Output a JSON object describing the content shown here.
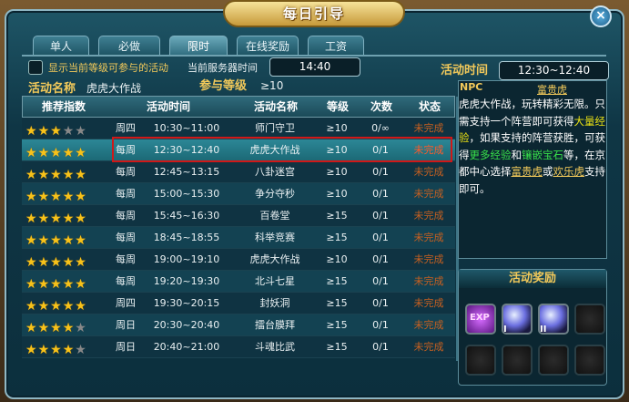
{
  "window": {
    "title": "每日引导",
    "close_label": "×"
  },
  "tabs": [
    {
      "label": "单人",
      "active": false
    },
    {
      "label": "必做",
      "active": false
    },
    {
      "label": "限时",
      "active": true
    },
    {
      "label": "在线奖励",
      "active": false
    },
    {
      "label": "工资",
      "active": false
    }
  ],
  "filter": {
    "checkbox_label": "显示当前等级可参与的活动",
    "server_time_label": "当前服务器时间",
    "server_time": "14:40"
  },
  "activity": {
    "name_label": "活动名称",
    "name_value": "虎虎大作战",
    "level_label": "参与等级",
    "level_value": "≥10"
  },
  "table": {
    "headers": [
      "推荐指数",
      "活动时间",
      "活动名称",
      "等级",
      "次数",
      "状态"
    ],
    "rows": [
      {
        "stars": 3,
        "day": "周四",
        "time": "10:30~11:00",
        "name": "师门守卫",
        "level": "≥10",
        "count": "0/∞",
        "status": "未完成"
      },
      {
        "stars": 5,
        "day": "每周",
        "time": "12:30~12:40",
        "name": "虎虎大作战",
        "level": "≥10",
        "count": "0/1",
        "status": "未完成",
        "selected": true
      },
      {
        "stars": 5,
        "day": "每周",
        "time": "12:45~13:15",
        "name": "八卦迷宫",
        "level": "≥10",
        "count": "0/1",
        "status": "未完成"
      },
      {
        "stars": 5,
        "day": "每周",
        "time": "15:00~15:30",
        "name": "争分夺秒",
        "level": "≥10",
        "count": "0/1",
        "status": "未完成"
      },
      {
        "stars": 5,
        "day": "每周",
        "time": "15:45~16:30",
        "name": "百卷堂",
        "level": "≥15",
        "count": "0/1",
        "status": "未完成"
      },
      {
        "stars": 5,
        "day": "每周",
        "time": "18:45~18:55",
        "name": "科举竞赛",
        "level": "≥15",
        "count": "0/1",
        "status": "未完成"
      },
      {
        "stars": 5,
        "day": "每周",
        "time": "19:00~19:10",
        "name": "虎虎大作战",
        "level": "≥10",
        "count": "0/1",
        "status": "未完成"
      },
      {
        "stars": 5,
        "day": "每周",
        "time": "19:20~19:30",
        "name": "北斗七星",
        "level": "≥15",
        "count": "0/1",
        "status": "未完成"
      },
      {
        "stars": 5,
        "day": "周四",
        "time": "19:30~20:15",
        "name": "封妖洞",
        "level": "≥15",
        "count": "0/1",
        "status": "未完成"
      },
      {
        "stars": 4,
        "day": "周日",
        "time": "20:30~20:40",
        "name": "擂台膜拜",
        "level": "≥15",
        "count": "0/1",
        "status": "未完成"
      },
      {
        "stars": 4,
        "day": "周日",
        "time": "20:40~21:00",
        "name": "斗魂比武",
        "level": "≥15",
        "count": "0/1",
        "status": "未完成"
      }
    ]
  },
  "detail": {
    "time_label": "活动时间",
    "time_value": "12:30~12:40",
    "npc_label": "NPC",
    "npc_value": "富贵虎",
    "desc_parts": [
      {
        "t": "虎虎大作战，玩转精彩无限。只需支持一个阵营即可获得",
        "c": ""
      },
      {
        "t": "大量经验",
        "c": "y"
      },
      {
        "t": "，如果支持的阵营获胜，可获得",
        "c": ""
      },
      {
        "t": "更多经验",
        "c": "gr"
      },
      {
        "t": "和",
        "c": ""
      },
      {
        "t": "镶嵌宝石",
        "c": "gr"
      },
      {
        "t": "等，在京都中心选择",
        "c": ""
      },
      {
        "t": "富贵虎",
        "c": "u"
      },
      {
        "t": "或",
        "c": ""
      },
      {
        "t": "欢乐虎",
        "c": "u"
      },
      {
        "t": "支持即可。",
        "c": ""
      }
    ]
  },
  "reward": {
    "title": "活动奖励",
    "slots": [
      {
        "icon": "exp-icon",
        "label": "EXP"
      },
      {
        "icon": "gem-icon",
        "label": "I"
      },
      {
        "icon": "gem-icon",
        "label": "II"
      },
      {
        "icon": "empty-slot"
      },
      {
        "icon": "empty-slot"
      },
      {
        "icon": "empty-slot"
      },
      {
        "icon": "empty-slot"
      },
      {
        "icon": "empty-slot"
      }
    ]
  }
}
